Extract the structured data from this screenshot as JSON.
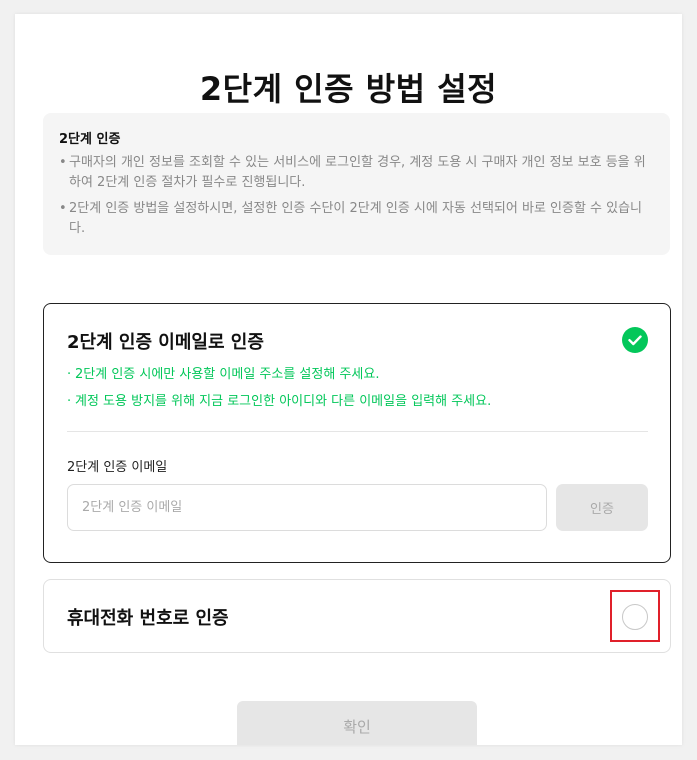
{
  "page": {
    "title": "2단계 인증 방법 설정"
  },
  "notice": {
    "title": "2단계 인증",
    "items": [
      "구매자의 개인 정보를 조회할 수 있는 서비스에 로그인할 경우, 계정 도용 시 구매자 개인 정보 보호 등을 위하여 2단계 인증 절차가 필수로 진행됩니다.",
      "2단계 인증 방법을 설정하시면, 설정한 인증 수단이 2단계 인증 시에 자동 선택되어 바로 인증할 수 있습니다."
    ]
  },
  "email_option": {
    "title": "2단계 인증 이메일로 인증",
    "selected": true,
    "hints": [
      "2단계 인증 시에만 사용할 이메일 주소를 설정해 주세요.",
      "계정 도용 방지를 위해 지금 로그인한 아이디와 다른 이메일을 입력해 주세요."
    ],
    "field_label": "2단계 인증 이메일",
    "input_value": "",
    "input_placeholder": "2단계 인증 이메일",
    "verify_label": "인증"
  },
  "phone_option": {
    "title": "휴대전화 번호로 인증",
    "selected": false
  },
  "confirm_label": "확인",
  "colors": {
    "accent": "#03c75a",
    "highlight": "#e0202a",
    "disabled": "#e6e6e6"
  },
  "icons": {
    "selected": "check-circle-icon",
    "unselected": "radio-circle-icon"
  }
}
